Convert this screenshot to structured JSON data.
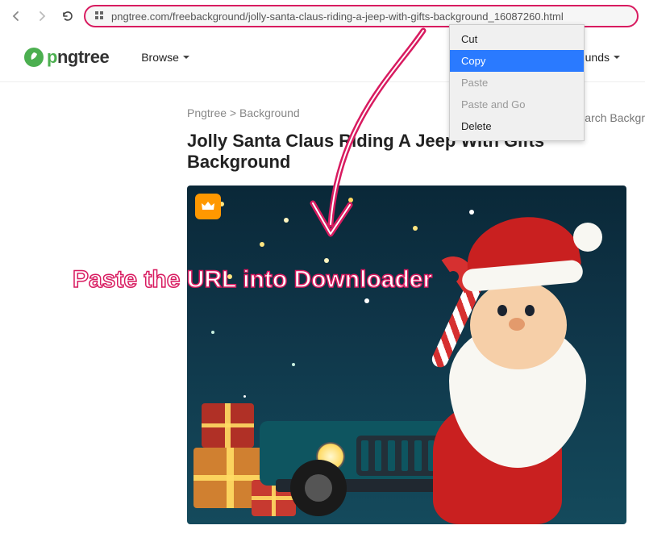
{
  "browser": {
    "url": "pngtree.com/freebackground/jolly-santa-claus-riding-a-jeep-with-gifts-background_16087260.html"
  },
  "context_menu": {
    "items": [
      {
        "label": "Cut",
        "state": "normal"
      },
      {
        "label": "Copy",
        "state": "highlighted"
      },
      {
        "label": "Paste",
        "state": "disabled"
      },
      {
        "label": "Paste and Go",
        "state": "disabled"
      },
      {
        "label": "Delete",
        "state": "normal"
      }
    ]
  },
  "header": {
    "logo_p": "p",
    "logo_rest": "ngtree",
    "browse": "Browse",
    "backgrounds": "rounds",
    "search_fragment": "earch Backgr"
  },
  "breadcrumb": {
    "text": "Pngtree  >  Background"
  },
  "page": {
    "title": "Jolly Santa Claus Riding A Jeep With Gifts Background"
  },
  "annotation": {
    "text": "Paste the URL into Downloader"
  }
}
